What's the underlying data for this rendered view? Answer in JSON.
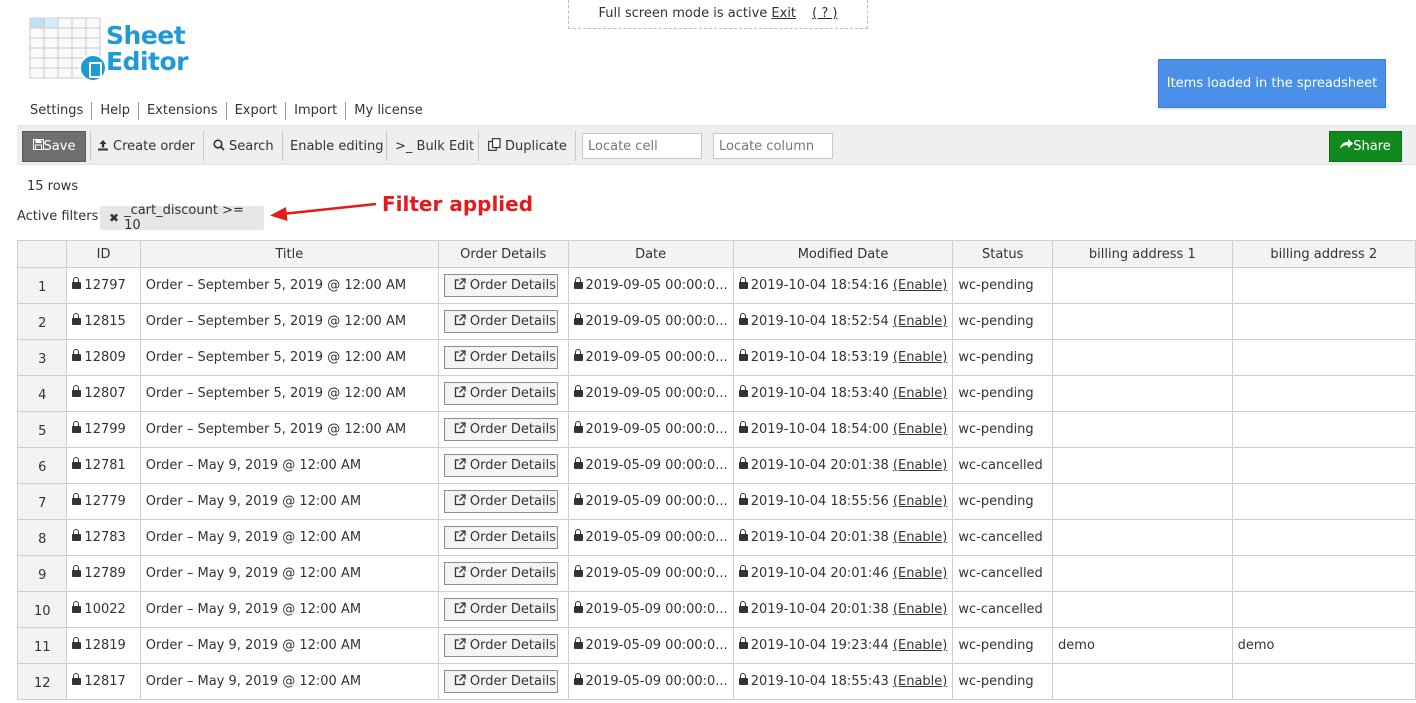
{
  "fullscreen_notice": {
    "text": "Full screen mode is active",
    "exit_label": "Exit",
    "help_label": "( ? )"
  },
  "logo": {
    "word1": "Sheet",
    "word2": "Editor"
  },
  "top_menu": [
    "Settings",
    "Help",
    "Extensions",
    "Export",
    "Import",
    "My license"
  ],
  "items_loaded_button": "Items loaded in the spreadsheet",
  "toolbar": {
    "save_label": "Save",
    "create_order_label": "Create order",
    "search_label": "Search",
    "enable_editing_label": "Enable editing",
    "bulk_edit_label": ">_ Bulk Edit",
    "duplicate_label": "Duplicate",
    "locate_cell_placeholder": "Locate cell",
    "locate_column_placeholder": "Locate column",
    "share_label": "Share"
  },
  "rows_count": "15 rows",
  "active_filters": {
    "label": "Active filters:",
    "filter": "_cart_discount >= 10"
  },
  "annotation": {
    "text": "Filter applied",
    "color": "#e31b1b"
  },
  "colors": {
    "save": "#6f6f6f",
    "share": "#118a1d",
    "items_loaded": "#4a8fe8",
    "logo": "#1e9ad6"
  },
  "table": {
    "columns": [
      "",
      "ID",
      "Title",
      "Order Details",
      "Date",
      "Modified Date",
      "Status",
      "billing address 1",
      "billing address 2"
    ],
    "order_details_label": "Order Details",
    "enable_label": "(Enable)",
    "rows": [
      {
        "num": "1",
        "id": "12797",
        "title": "Order – September 5, 2019 @ 12:00 AM",
        "date": "2019-09-05 00:00:0...",
        "modified": "2019-10-04 18:54:16",
        "status": "wc-pending",
        "billing1": "",
        "billing2": ""
      },
      {
        "num": "2",
        "id": "12815",
        "title": "Order – September 5, 2019 @ 12:00 AM",
        "date": "2019-09-05 00:00:0...",
        "modified": "2019-10-04 18:52:54",
        "status": "wc-pending",
        "billing1": "",
        "billing2": ""
      },
      {
        "num": "3",
        "id": "12809",
        "title": "Order – September 5, 2019 @ 12:00 AM",
        "date": "2019-09-05 00:00:0...",
        "modified": "2019-10-04 18:53:19",
        "status": "wc-pending",
        "billing1": "",
        "billing2": ""
      },
      {
        "num": "4",
        "id": "12807",
        "title": "Order – September 5, 2019 @ 12:00 AM",
        "date": "2019-09-05 00:00:0...",
        "modified": "2019-10-04 18:53:40",
        "status": "wc-pending",
        "billing1": "",
        "billing2": ""
      },
      {
        "num": "5",
        "id": "12799",
        "title": "Order – September 5, 2019 @ 12:00 AM",
        "date": "2019-09-05 00:00:0...",
        "modified": "2019-10-04 18:54:00",
        "status": "wc-pending",
        "billing1": "",
        "billing2": ""
      },
      {
        "num": "6",
        "id": "12781",
        "title": "Order – May 9, 2019 @ 12:00 AM",
        "date": "2019-05-09 00:00:0...",
        "modified": "2019-10-04 20:01:38",
        "status": "wc-cancelled",
        "billing1": "",
        "billing2": ""
      },
      {
        "num": "7",
        "id": "12779",
        "title": "Order – May 9, 2019 @ 12:00 AM",
        "date": "2019-05-09 00:00:0...",
        "modified": "2019-10-04 18:55:56",
        "status": "wc-pending",
        "billing1": "",
        "billing2": ""
      },
      {
        "num": "8",
        "id": "12783",
        "title": "Order – May 9, 2019 @ 12:00 AM",
        "date": "2019-05-09 00:00:0...",
        "modified": "2019-10-04 20:01:38",
        "status": "wc-cancelled",
        "billing1": "",
        "billing2": ""
      },
      {
        "num": "9",
        "id": "12789",
        "title": "Order – May 9, 2019 @ 12:00 AM",
        "date": "2019-05-09 00:00:0...",
        "modified": "2019-10-04 20:01:46",
        "status": "wc-cancelled",
        "billing1": "",
        "billing2": ""
      },
      {
        "num": "10",
        "id": "10022",
        "title": "Order – May 9, 2019 @ 12:00 AM",
        "date": "2019-05-09 00:00:0...",
        "modified": "2019-10-04 20:01:38",
        "status": "wc-cancelled",
        "billing1": "",
        "billing2": ""
      },
      {
        "num": "11",
        "id": "12819",
        "title": "Order – May 9, 2019 @ 12:00 AM",
        "date": "2019-05-09 00:00:0...",
        "modified": "2019-10-04 19:23:44",
        "status": "wc-pending",
        "billing1": "demo",
        "billing2": "demo"
      },
      {
        "num": "12",
        "id": "12817",
        "title": "Order – May 9, 2019 @ 12:00 AM",
        "date": "2019-05-09 00:00:0...",
        "modified": "2019-10-04 18:55:43",
        "status": "wc-pending",
        "billing1": "",
        "billing2": ""
      }
    ]
  }
}
